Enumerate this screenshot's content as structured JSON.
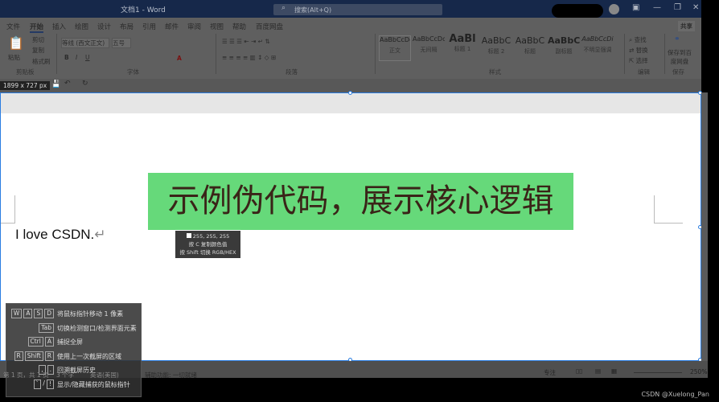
{
  "titlebar": {
    "title": "文档1  -  Word",
    "search_placeholder": "搜索(Alt+Q)",
    "minimize": "—",
    "restore": "❐",
    "close": "✕"
  },
  "ribbon": {
    "tabs": [
      "文件",
      "开始",
      "插入",
      "绘图",
      "设计",
      "布局",
      "引用",
      "邮件",
      "审阅",
      "视图",
      "帮助",
      "百度网盘"
    ],
    "active_tab": "开始",
    "share": "共享",
    "clipboard": {
      "paste": "粘贴",
      "cut": "剪切",
      "copy": "复制",
      "format_painter": "格式刷",
      "group": "剪贴板"
    },
    "font": {
      "name": "等线 (西文正文)",
      "size": "五号",
      "group": "字体"
    },
    "paragraph": {
      "group": "段落"
    },
    "styles": {
      "items": [
        {
          "preview": "AaBbCcDc",
          "name": "正文"
        },
        {
          "preview": "AaBbCcDc",
          "name": "无间隔"
        },
        {
          "preview": "AaBl",
          "name": "标题 1"
        },
        {
          "preview": "AaBbC",
          "name": "标题 2"
        },
        {
          "preview": "AaBbC",
          "name": "标题"
        },
        {
          "preview": "AaBbC",
          "name": "副标题"
        },
        {
          "preview": "AaBbCcDi",
          "name": "不明显强调"
        }
      ],
      "group": "样式"
    },
    "editing": {
      "find": "查找",
      "replace": "替换",
      "select": "选择",
      "group": "编辑"
    },
    "save": {
      "label": "保存到百度网盘",
      "group": "保存"
    }
  },
  "capture": {
    "size": "1899 x 727",
    "unit": "px"
  },
  "document": {
    "heading": "示例伪代码，展示核心逻辑",
    "text": "I love CSDN.",
    "heading_bg": "#66d97a"
  },
  "color_tip": {
    "rgb": "255, 255, 255",
    "line1": "按 C 复制颜色值",
    "line2": "按 Shift 切换 RGB/HEX"
  },
  "shortcuts": [
    {
      "keys": [
        "W",
        "A",
        "S",
        "D"
      ],
      "label": "将鼠标指针移动 1 像素"
    },
    {
      "keys": [
        "Tab"
      ],
      "label": "切换检测窗口/检测界面元素"
    },
    {
      "keys": [
        "Ctrl",
        "A"
      ],
      "label": "捕捉全屏"
    },
    {
      "keys": [
        "R",
        "Shift",
        "R"
      ],
      "label": "使用上一次截屏的区域"
    },
    {
      "keys": [
        ",",
        "."
      ],
      "label": "回溯截屏历史"
    },
    {
      "keys": [
        "`",
        "/",
        "!"
      ],
      "label": "显示/隐藏捕获的鼠标指针"
    }
  ],
  "status": {
    "page": "第 1 页，共 1 页",
    "words": "3 个字",
    "lang": "英语(美国)",
    "accessibility": "辅助功能: 一切就绪",
    "focus": "专注",
    "zoom": "250%"
  },
  "watermark": "CSDN @Xuelong_Pan"
}
